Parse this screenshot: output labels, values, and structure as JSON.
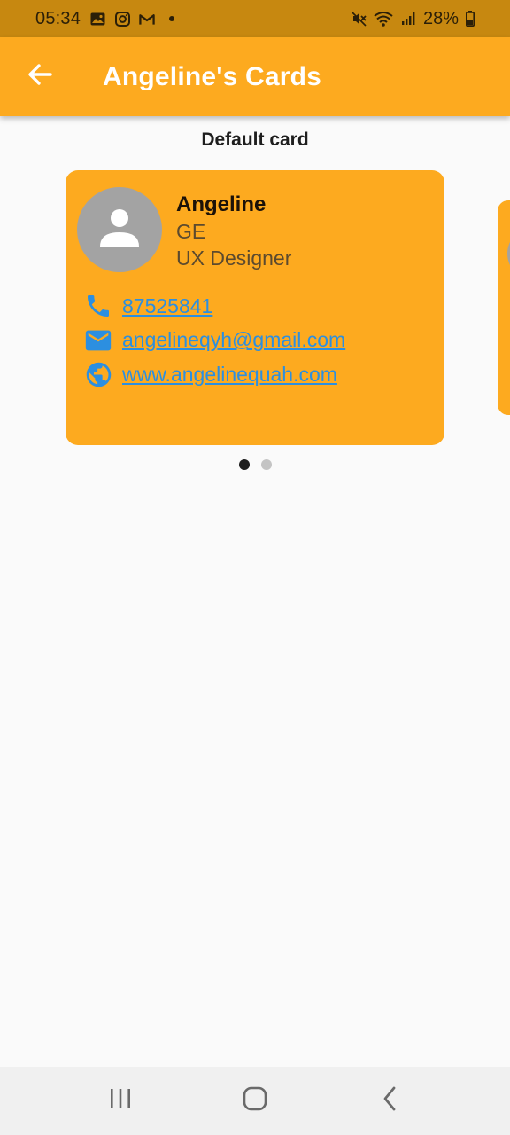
{
  "status_bar": {
    "time": "05:34",
    "battery": "28%",
    "icons": [
      "gallery-icon",
      "instagram-icon",
      "gmail-icon",
      "notification-dot-icon",
      "mute-icon",
      "wifi-icon",
      "signal-icon",
      "battery-icon"
    ]
  },
  "app_bar": {
    "title": "Angeline's Cards",
    "back_icon": "arrow-back-icon",
    "background": "#fdaa1f"
  },
  "section": {
    "title": "Default card"
  },
  "card": {
    "name": "Angeline",
    "department": "GE",
    "role": "UX Designer",
    "phone": "87525841",
    "email": "angelineqyh@gmail.com",
    "website": "www.angelinequah.com",
    "background": "#fdaa1f",
    "link_color": "#2c8fe0"
  },
  "carousel": {
    "page_count": 2,
    "active_index": 0
  },
  "nav_bar": {
    "buttons": [
      "recents-icon",
      "home-icon",
      "back-icon"
    ]
  }
}
